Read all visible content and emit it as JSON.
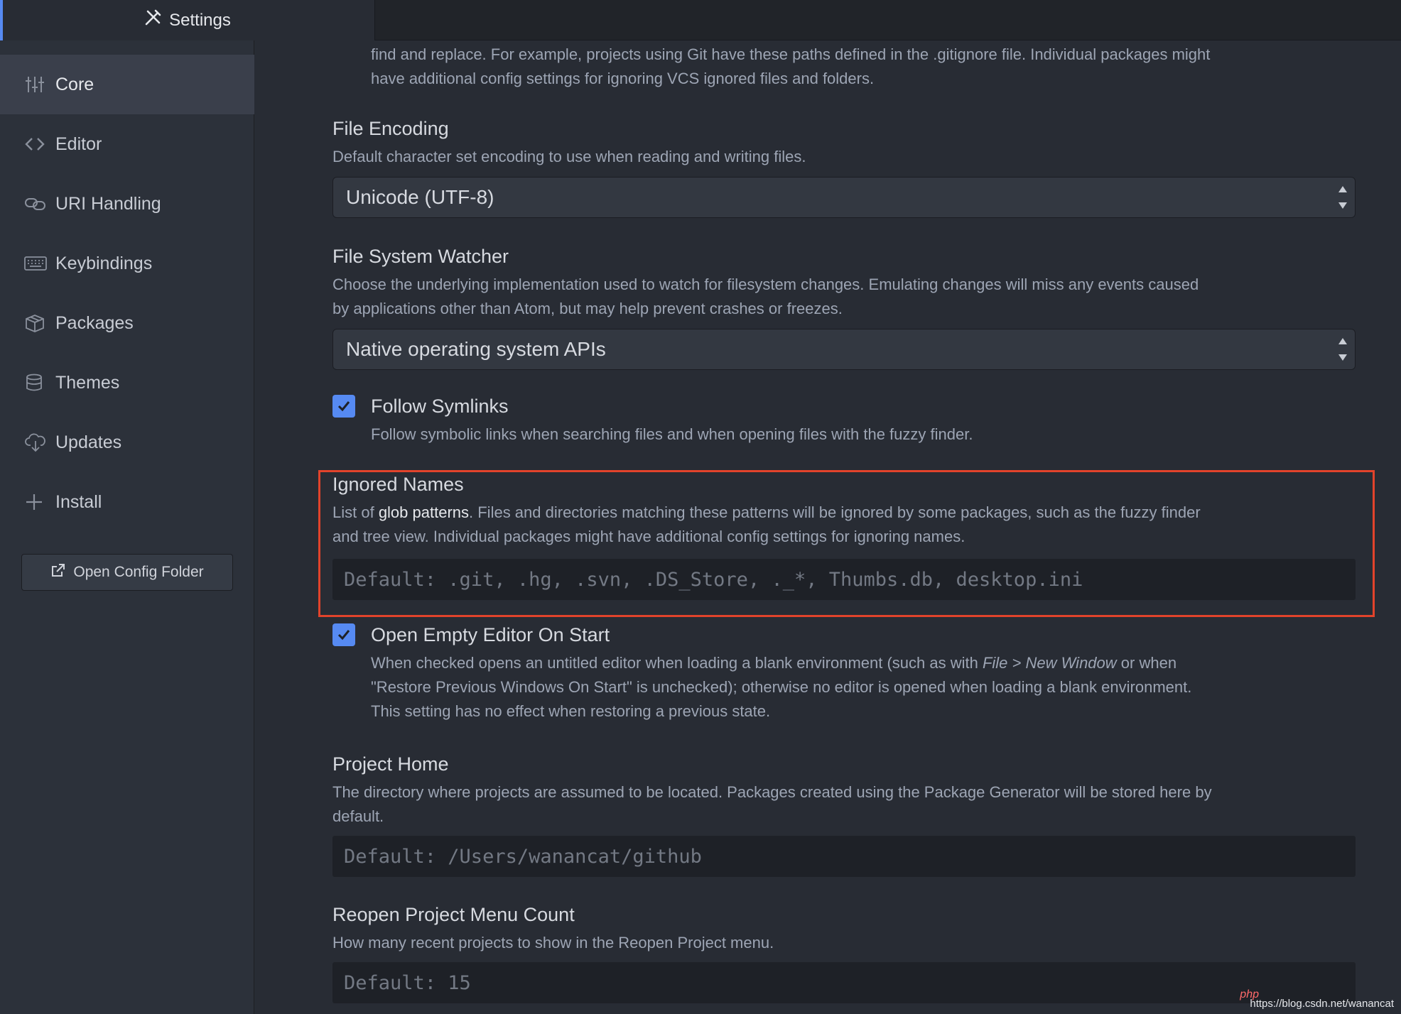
{
  "tab": {
    "title": "Settings",
    "icon": "tools-icon"
  },
  "sidebar": {
    "items": [
      {
        "label": "Core",
        "icon": "sliders-icon",
        "active": true
      },
      {
        "label": "Editor",
        "icon": "code-icon"
      },
      {
        "label": "URI Handling",
        "icon": "link-icon"
      },
      {
        "label": "Keybindings",
        "icon": "keyboard-icon"
      },
      {
        "label": "Packages",
        "icon": "package-icon"
      },
      {
        "label": "Themes",
        "icon": "paintcan-icon"
      },
      {
        "label": "Updates",
        "icon": "cloud-download-icon"
      },
      {
        "label": "Install",
        "icon": "plus-icon"
      }
    ],
    "open_config_label": "Open Config Folder"
  },
  "settings": {
    "intro_line1": "find and replace. For example, projects using Git have these paths defined in the .gitignore file. Individual packages might",
    "intro_line2": "have additional config settings for ignoring VCS ignored files and folders.",
    "file_encoding": {
      "title": "File Encoding",
      "desc": "Default character set encoding to use when reading and writing files.",
      "value": "Unicode (UTF-8)"
    },
    "file_system_watcher": {
      "title": "File System Watcher",
      "desc_line1": "Choose the underlying implementation used to watch for filesystem changes. Emulating changes will miss any events caused",
      "desc_line2": "by applications other than Atom, but may help prevent crashes or freezes.",
      "value": "Native operating system APIs"
    },
    "follow_symlinks": {
      "title": "Follow Symlinks",
      "desc": "Follow symbolic links when searching files and when opening files with the fuzzy finder.",
      "checked": true
    },
    "ignored_names": {
      "title": "Ignored Names",
      "desc_prefix": "List of ",
      "desc_link": "glob patterns",
      "desc_suffix": ". Files and directories matching these patterns will be ignored by some packages, such as the fuzzy finder",
      "desc_line2": "and tree view. Individual packages might have additional config settings for ignoring names.",
      "placeholder": "Default: .git, .hg, .svn, .DS_Store, ._*, Thumbs.db, desktop.ini"
    },
    "open_empty_editor": {
      "title": "Open Empty Editor On Start",
      "desc_line1_a": "When checked opens an untitled editor when loading a blank environment (such as with ",
      "desc_line1_em": "File > New Window",
      "desc_line1_b": " or when",
      "desc_line2": "\"Restore Previous Windows On Start\" is unchecked); otherwise no editor is opened when loading a blank environment.",
      "desc_line3": "This setting has no effect when restoring a previous state.",
      "checked": true
    },
    "project_home": {
      "title": "Project Home",
      "desc_line1": "The directory where projects are assumed to be located. Packages created using the Package Generator will be stored here by",
      "desc_line2": "default.",
      "placeholder": "Default: /Users/wanancat/github"
    },
    "reopen_project_menu_count": {
      "title": "Reopen Project Menu Count",
      "desc": "How many recent projects to show in the Reopen Project menu.",
      "placeholder": "Default: 15"
    }
  },
  "watermark": {
    "text": "https://blog.csdn.net/wanancat",
    "badge": "php"
  },
  "colors": {
    "accent": "#568af2",
    "highlight_border": "#e2432b"
  }
}
